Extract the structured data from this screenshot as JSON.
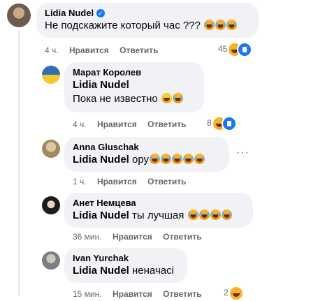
{
  "actions": {
    "like": "Нравится",
    "reply": "Ответить"
  },
  "comments": [
    {
      "author": "Lidia Nudel",
      "verified": true,
      "text": "Не подскажите который час ???",
      "emoji_count": 3,
      "time": "4 ч.",
      "reaction_count": "45",
      "avatar_color": "#6d5b4b"
    },
    {
      "author": "Марат Королев",
      "mention": "Lidia Nudel",
      "text": "Пока не известно",
      "time": "4 ч.",
      "reaction_count": "8",
      "avatar_color": "#2f6db5"
    },
    {
      "author": "Anna Gluschak",
      "mention": "Lidia Nudel",
      "text": "ору",
      "time": "1 ч.",
      "avatar_color": "#a08a5c"
    },
    {
      "author": "Анет Немцева",
      "mention": "Lidia Nudel",
      "text": "ты лучшая",
      "time": "36 мин.",
      "avatar_color": "#1c1c1c"
    },
    {
      "author": "Ivan Yurchak",
      "mention": "Lidia Nudel",
      "text": "неначасі",
      "time": "15 мин.",
      "reaction_count": "2",
      "avatar_color": "#7b7f85"
    }
  ]
}
